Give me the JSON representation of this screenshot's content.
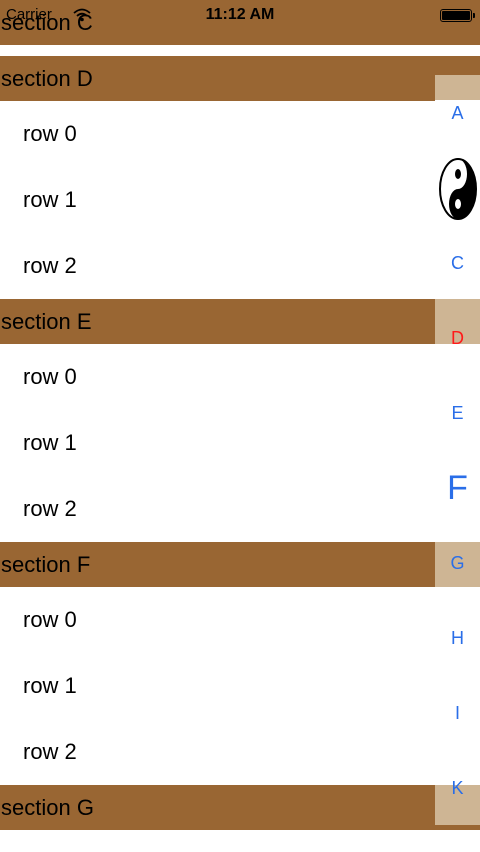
{
  "status_bar": {
    "carrier": "Carrier",
    "time": "11:12 AM"
  },
  "sections": [
    {
      "title": "section C",
      "rows": []
    },
    {
      "title": "section D",
      "rows": [
        "row 0",
        "row 1",
        "row 2"
      ]
    },
    {
      "title": "section E",
      "rows": [
        "row 0",
        "row 1",
        "row 2"
      ]
    },
    {
      "title": "section F",
      "rows": [
        "row 0",
        "row 1",
        "row 2"
      ]
    },
    {
      "title": "section G",
      "rows": []
    }
  ],
  "index": {
    "items": [
      "A",
      "yin-yang",
      "C",
      "D",
      "E",
      "F",
      "G",
      "H",
      "I",
      "K"
    ],
    "selected": "D",
    "colors": {
      "text": "#2a6ee8",
      "selected": "#ff1a1a",
      "highlight": "#ceb594"
    }
  },
  "colors": {
    "section_header": "#996633"
  }
}
